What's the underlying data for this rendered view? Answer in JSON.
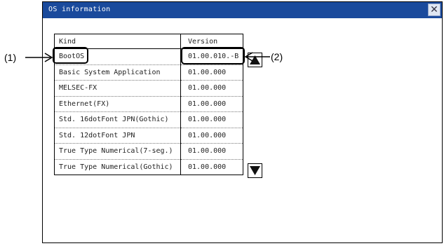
{
  "window": {
    "title": "OS information",
    "close_icon": "close-icon"
  },
  "table": {
    "headers": [
      "Kind",
      "Version"
    ],
    "rows": [
      [
        "BootOS",
        "01.00.010.-B"
      ],
      [
        "Basic System Application",
        "01.00.000"
      ],
      [
        "MELSEC-FX",
        "01.00.000"
      ],
      [
        "Ethernet(FX)",
        "01.00.000"
      ],
      [
        "Std. 16dotFont JPN(Gothic)",
        "01.00.000"
      ],
      [
        "Std. 12dotFont JPN",
        "01.00.000"
      ],
      [
        "True Type Numerical(7-seg.)",
        "01.00.000"
      ],
      [
        "True Type Numerical(Gothic)",
        "01.00.000"
      ]
    ]
  },
  "scroll": {
    "up_icon": "triangle-up-icon",
    "down_icon": "triangle-down-icon"
  },
  "callouts": {
    "left": "(1)",
    "right": "(2)"
  },
  "colors": {
    "titlebar": "#1a4a9c",
    "title_text": "#ffffff"
  }
}
